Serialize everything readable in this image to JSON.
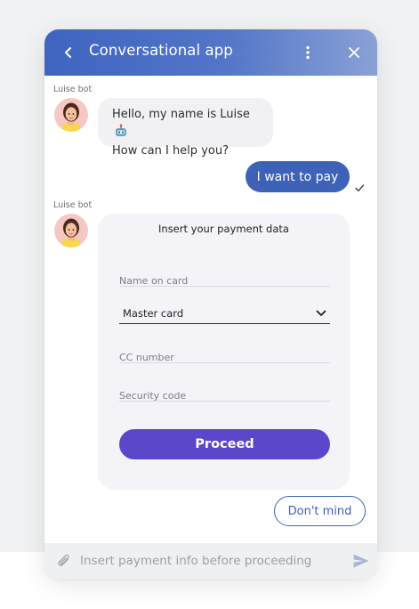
{
  "header": {
    "title": "Conversational app",
    "back_icon": "chevron-left-icon",
    "more_icon": "more-vertical-icon",
    "close_icon": "close-icon",
    "gradient_colors": [
      "#3f64c0",
      "#8aa1d6"
    ]
  },
  "messages": [
    {
      "sender": "Luise bot",
      "lines": [
        "Hello, my name is Luise",
        "How can I help you?"
      ],
      "emoji_icon": "robot-icon"
    },
    {
      "sender": "user",
      "text": "I want to pay",
      "status_icon": "checkmark-icon"
    },
    {
      "sender": "Luise bot"
    }
  ],
  "payment_form": {
    "title": "Insert your payment data",
    "name_placeholder": "Name on card",
    "card_type_value": "Master card",
    "cc_placeholder": "CC number",
    "security_placeholder": "Security code",
    "proceed_label": "Proceed"
  },
  "quick_reply": {
    "label": "Don't mind"
  },
  "composer": {
    "placeholder": "Insert payment info before proceeding",
    "attach_icon": "paperclip-icon",
    "send_icon": "send-icon"
  },
  "colors": {
    "accent": "#3d62b8",
    "primary_button": "#5b47c9",
    "bot_bubble": "#f1f1f4",
    "form_card": "#f3f3f8"
  }
}
